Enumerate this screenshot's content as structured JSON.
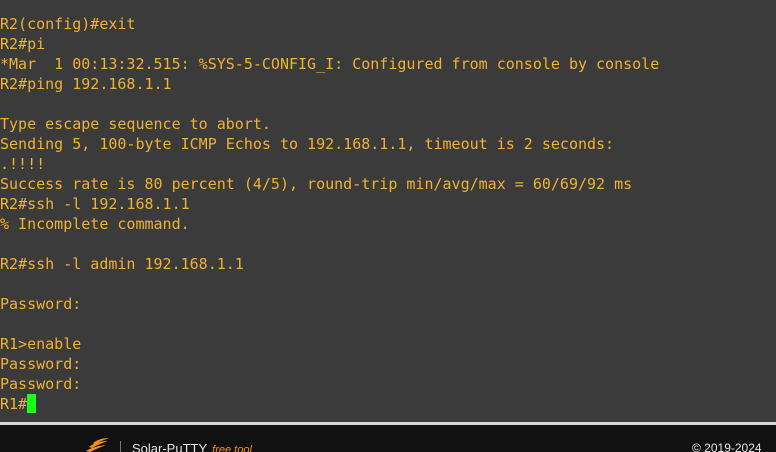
{
  "terminal": {
    "lines": [
      "R2(config)#exit",
      "R2#pi",
      "*Mar  1 00:13:32.515: %SYS-5-CONFIG_I: Configured from console by console",
      "R2#ping 192.168.1.1",
      "",
      "Type escape sequence to abort.",
      "Sending 5, 100-byte ICMP Echos to 192.168.1.1, timeout is 2 seconds:",
      ".!!!!",
      "Success rate is 80 percent (4/5), round-trip min/avg/max = 60/69/92 ms",
      "R2#ssh -l 192.168.1.1",
      "% Incomplete command.",
      "",
      "R2#ssh -l admin 192.168.1.1",
      "",
      "Password:",
      "",
      "R1>enable",
      "Password:",
      "Password:"
    ],
    "prompt": "R1#",
    "text_color": "#f0b232",
    "cursor_color": "#19ff19",
    "background_color": "#3b3b3b"
  },
  "footer": {
    "product_name": "Solar-PuTTY",
    "product_tag": "free tool",
    "copyright": "© 2019-2024",
    "logo_icon": "solarwinds-flame-icon",
    "accent_color": "#f7941d"
  }
}
